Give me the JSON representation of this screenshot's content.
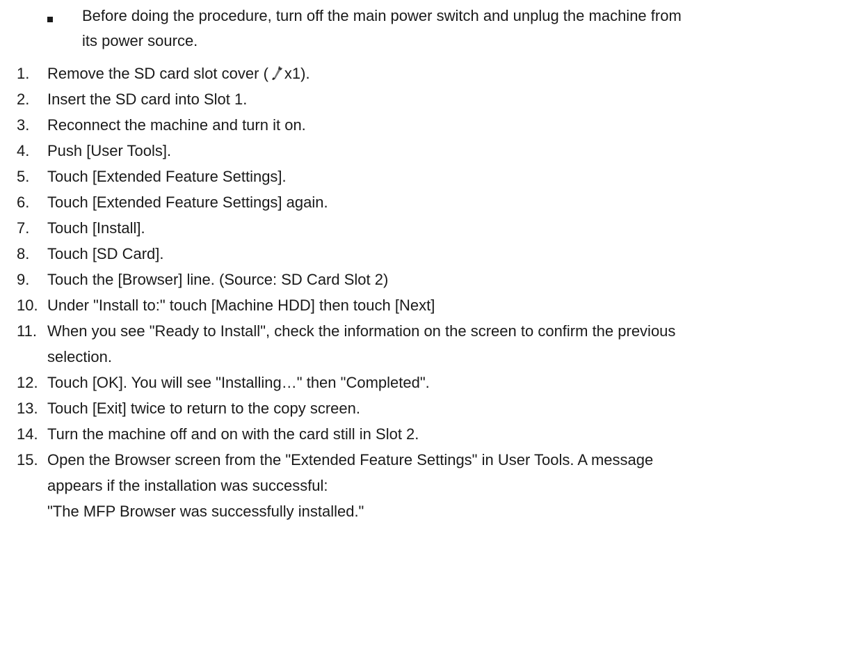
{
  "note": {
    "lines": [
      "Before doing the procedure, turn off the main power switch and unplug the machine from",
      "its power source."
    ]
  },
  "steps": [
    {
      "num": "1.",
      "lines": [
        "Remove the SD card slot cover (",
        "x1)."
      ],
      "icon": "screw-icon"
    },
    {
      "num": "2.",
      "lines": [
        "Insert the SD card into Slot 1."
      ]
    },
    {
      "num": "3.",
      "lines": [
        "Reconnect the machine and turn it on."
      ]
    },
    {
      "num": "4.",
      "lines": [
        "Push [User Tools]."
      ]
    },
    {
      "num": "5.",
      "lines": [
        "Touch [Extended Feature Settings]."
      ]
    },
    {
      "num": "6.",
      "lines": [
        "Touch [Extended Feature Settings] again."
      ]
    },
    {
      "num": "7.",
      "lines": [
        "Touch [Install]."
      ]
    },
    {
      "num": "8.",
      "lines": [
        "Touch [SD Card]."
      ]
    },
    {
      "num": "9.",
      "lines": [
        "Touch the [Browser] line. (Source: SD Card Slot 2)"
      ]
    },
    {
      "num": "10.",
      "lines": [
        "Under \"Install to:\" touch [Machine HDD] then touch [Next]"
      ]
    },
    {
      "num": "11.",
      "lines": [
        "When you see \"Ready to Install\", check the information on the screen to confirm the previous",
        "selection."
      ]
    },
    {
      "num": "12.",
      "lines": [
        "Touch [OK]. You will see \"Installing…\" then \"Completed\"."
      ]
    },
    {
      "num": "13.",
      "lines": [
        "Touch [Exit] twice to return to the copy screen."
      ]
    },
    {
      "num": "14.",
      "lines": [
        "Turn the machine off and on with the card still in Slot 2."
      ]
    },
    {
      "num": "15.",
      "lines": [
        "Open the Browser screen from the \"Extended Feature Settings\" in User Tools. A message",
        "appears if the installation was successful:",
        "\"The MFP Browser was successfully installed.\""
      ]
    }
  ]
}
